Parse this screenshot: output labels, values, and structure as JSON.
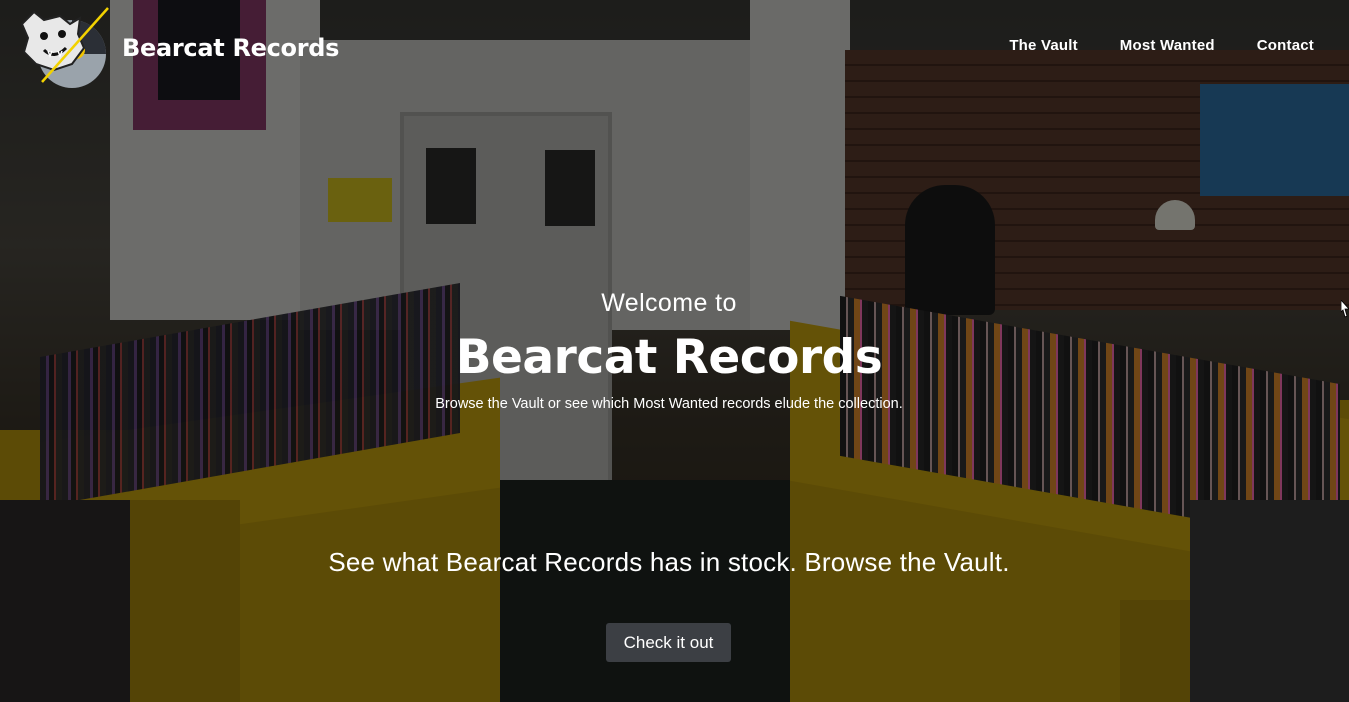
{
  "header": {
    "brand_name": "Bearcat Records",
    "nav": [
      {
        "label": "The Vault"
      },
      {
        "label": "Most Wanted"
      },
      {
        "label": "Contact"
      }
    ]
  },
  "hero": {
    "welcome": "Welcome to",
    "title": "Bearcat Records",
    "subtitle": "Browse the Vault or see which Most Wanted records elude the collection.",
    "cta_text": "See what Bearcat Records has in stock. Browse the Vault.",
    "cta_button": "Check it out"
  },
  "colors": {
    "button_bg": "#3c3f44",
    "overlay": "rgba(0,0,0,0.5)",
    "text": "#ffffff"
  },
  "icons": {
    "logo": "bearcat-logo-icon"
  }
}
